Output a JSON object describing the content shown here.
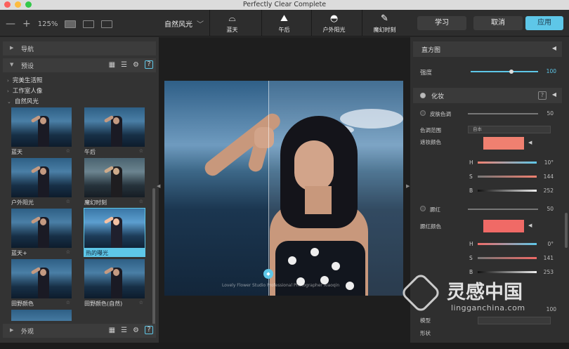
{
  "window": {
    "title": "Perfectly Clear Complete"
  },
  "toolbar": {
    "minus": "—",
    "plus": "+",
    "zoom": "125%",
    "preset_selected": "自然风光",
    "quick_presets": [
      {
        "label": "蓝天",
        "icon": "sky-icon"
      },
      {
        "label": "午后",
        "icon": "afternoon-icon"
      },
      {
        "label": "户外阳光",
        "icon": "outdoor-sun-icon"
      },
      {
        "label": "魔幻时刻",
        "icon": "magic-hour-icon"
      }
    ],
    "learn": "学习",
    "cancel": "取消",
    "apply": "应用"
  },
  "left": {
    "nav_label": "导航",
    "presets_label": "预设",
    "categories": [
      "完美生活照",
      "工作室人像",
      "自然风光"
    ],
    "thumbs": [
      {
        "label": "蓝天",
        "selected": false
      },
      {
        "label": "午后",
        "selected": false
      },
      {
        "label": "户外阳光",
        "selected": false
      },
      {
        "label": "魔幻时刻",
        "selected": false
      },
      {
        "label": "蓝天+",
        "selected": false
      },
      {
        "label": "热的曝光",
        "selected": true
      },
      {
        "label": "田野颜色",
        "selected": false
      },
      {
        "label": "田野颜色(自然)",
        "selected": false
      }
    ],
    "appearance_label": "外观",
    "help": "?"
  },
  "photo": {
    "signature": "Lovely Flower Studio Professional Photographer Xiaoqin"
  },
  "right": {
    "histogram_label": "直方图",
    "strength_label": "强度",
    "strength_value": "100",
    "strength_level": 0.6,
    "makeup_label": "化妆",
    "help": "?",
    "skin_tone_label": "皮肤色调",
    "skin_tone_value": "50",
    "color_range_label": "色调范围",
    "color_range_value": "自本",
    "mask_color_label": "遮妆颜色",
    "mask_color": "#f08070",
    "h1": {
      "label": "H",
      "value": "10°"
    },
    "s1": {
      "label": "S",
      "value": "144"
    },
    "b1": {
      "label": "B",
      "value": "252"
    },
    "blush_label": "腮红",
    "blush_value": "50",
    "blush_color_label": "腮红颜色",
    "blush_color": "#f06a66",
    "h2": {
      "label": "H",
      "value": "0°"
    },
    "s2": {
      "label": "S",
      "value": "141"
    },
    "b2": {
      "label": "B",
      "value": "253"
    },
    "v_100": "100",
    "mode_label": "模型",
    "shape_label": "形状"
  },
  "watermark": {
    "cn": "灵感中国",
    "en": "lingganchina.com"
  },
  "colors": {
    "accent": "#5ec7e8"
  }
}
